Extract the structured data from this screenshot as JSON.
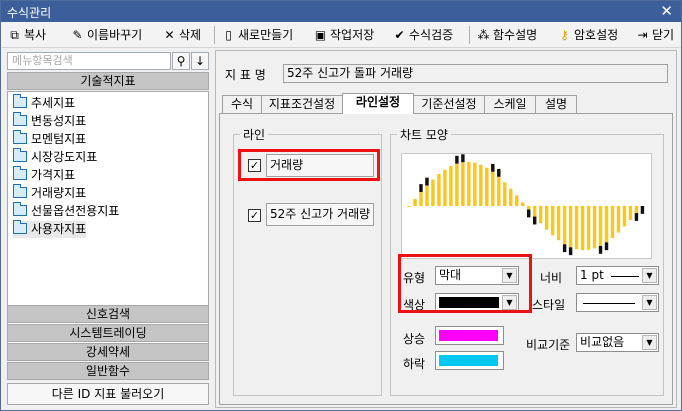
{
  "window": {
    "title": "수식관리",
    "close_label": "✕"
  },
  "toolbar": {
    "copy": "복사",
    "rename": "이름바꾸기",
    "delete": "삭제",
    "new": "새로만들기",
    "save": "작업저장",
    "verify": "수식검증",
    "func_help": "함수설명",
    "password": "암호설정",
    "close": "닫기"
  },
  "sidebar": {
    "search_placeholder": "메뉴항목검색",
    "category_header": "기술적지표",
    "items": [
      "추세지표",
      "변동성지표",
      "모멘텀지표",
      "시장강도지표",
      "가격지표",
      "거래량지표",
      "선물옵션전용지표",
      "사용자지표"
    ],
    "sections": [
      "신호검색",
      "시스템트레이딩",
      "강세약세",
      "일반함수"
    ],
    "load_button": "다른 ID 지표 불러오기"
  },
  "indicator": {
    "name_label": "지 표 명",
    "name_value": "52주 신고가 돌파 거래량"
  },
  "tabs": [
    "수식",
    "지표조건설정",
    "라인설정",
    "기준선설정",
    "스케일",
    "설명"
  ],
  "active_tab": "라인설정",
  "line_group": {
    "title": "라인",
    "lines": [
      {
        "label": "거래량",
        "checked": true
      },
      {
        "label": "52주 신고가 거래량",
        "checked": true
      }
    ]
  },
  "chart_group": {
    "title": "차트 모양",
    "type_label": "유형",
    "type_value": "막대",
    "color_label": "색상",
    "color_value": "#000000",
    "up_label": "상승",
    "up_color": "#ff00ff",
    "down_label": "하락",
    "down_color": "#00c8f0",
    "width_label": "너비",
    "width_value": "1 pt",
    "style_label": "스타일",
    "compare_label": "비교기준",
    "compare_value": "비교없음"
  },
  "preview_colors": {
    "bar": "#f8c81c",
    "dark": "#111111"
  }
}
